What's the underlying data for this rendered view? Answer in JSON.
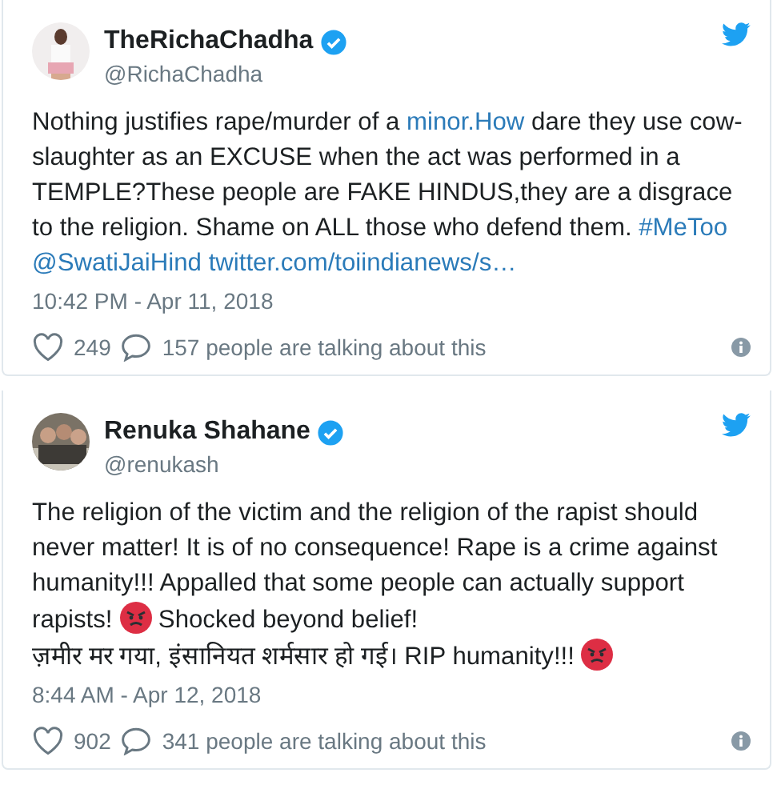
{
  "tweets": [
    {
      "name": "TheRichaChadha",
      "verified": true,
      "handle": "@RichaChadha",
      "body": [
        {
          "kind": "text",
          "text": "Nothing justifies rape/murder of a "
        },
        {
          "kind": "link",
          "text": "minor.How"
        },
        {
          "kind": "text",
          "text": " dare they use cow-slaughter as an EXCUSE when the act was performed in a TEMPLE?These people are FAKE HINDUS,they are a disgrace to the religion. Shame on ALL those who defend them. "
        },
        {
          "kind": "link",
          "text": "#MeToo"
        },
        {
          "kind": "link",
          "text": "@SwatiJaiHind"
        },
        {
          "kind": "link",
          "text": "twitter.com/toiindianews/s…"
        }
      ],
      "timestamp": "10:42 PM - Apr 11, 2018",
      "likes": "249",
      "talking": "157 people are talking about this"
    },
    {
      "name": "Renuka Shahane",
      "verified": true,
      "handle": "@renukash",
      "body": [
        {
          "kind": "text",
          "text": "The religion of the victim and the religion of the rapist should never matter! It is of no consequence! Rape is a crime against humanity!!! Appalled that some people can actually support rapists! "
        },
        {
          "kind": "emoji"
        },
        {
          "kind": "text",
          "text": " Shocked beyond belief!"
        },
        {
          "kind": "break"
        },
        {
          "kind": "text",
          "text": "ज़मीर मर गया, इंसानियत शर्मसार हो गई। RIP humanity!!! "
        },
        {
          "kind": "emoji"
        }
      ],
      "timestamp": "8:44 AM - Apr 12, 2018",
      "likes": "902",
      "talking": "341 people are talking about this"
    }
  ]
}
